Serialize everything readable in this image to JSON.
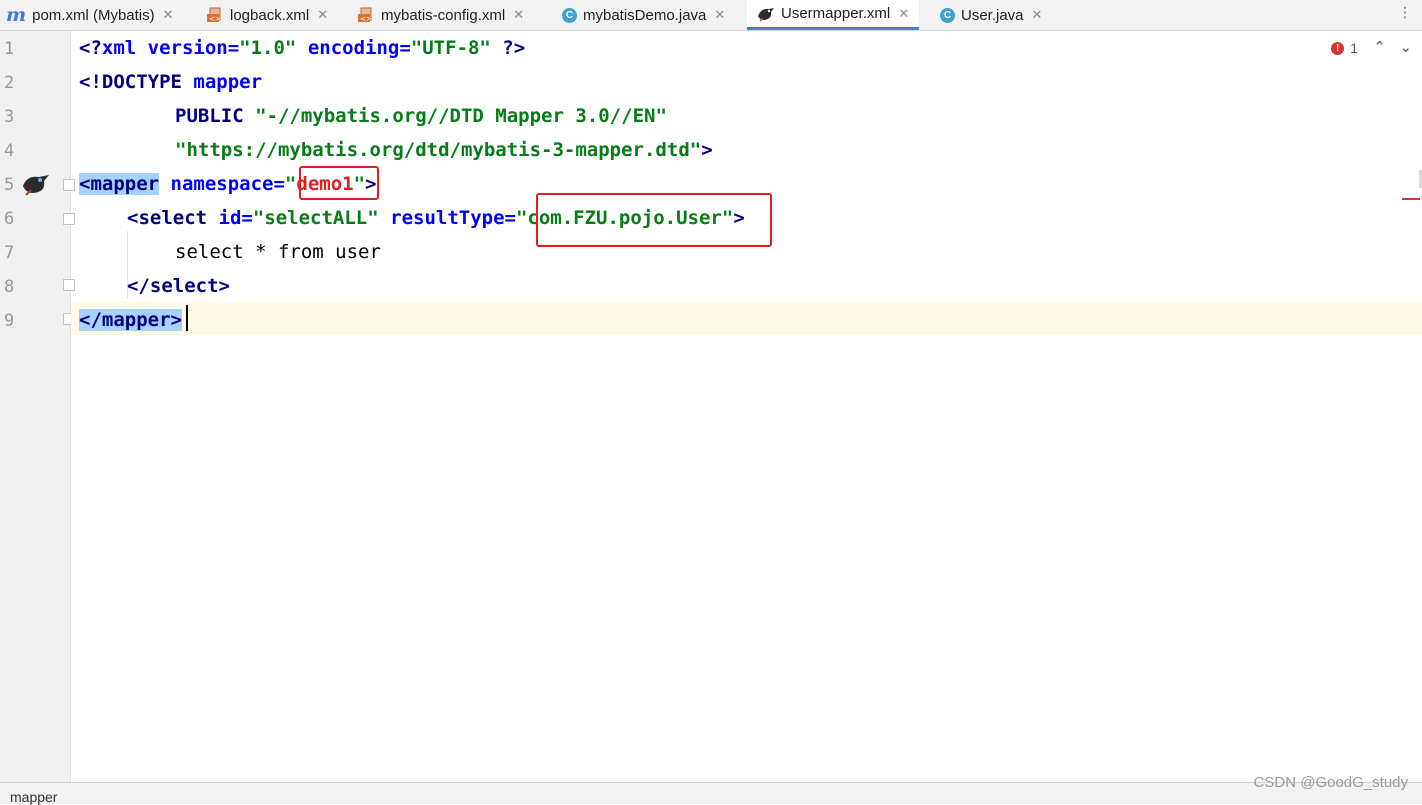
{
  "tabs": [
    {
      "label": "pom.xml (Mybatis)",
      "icon": "maven-icon",
      "close": "✕",
      "active": false
    },
    {
      "label": "logback.xml",
      "icon": "xml-file-icon",
      "close": "✕",
      "active": false
    },
    {
      "label": "mybatis-config.xml",
      "icon": "xml-file-icon",
      "close": "✕",
      "active": false
    },
    {
      "label": "mybatisDemo.java",
      "icon": "java-class-icon",
      "close": "✕",
      "active": false
    },
    {
      "label": "Usermapper.xml",
      "icon": "mybatis-bird-icon",
      "close": "✕",
      "active": true
    },
    {
      "label": "User.java",
      "icon": "java-class-icon",
      "close": "✕",
      "active": false
    }
  ],
  "gutter": {
    "line_numbers": [
      "1",
      "2",
      "3",
      "4",
      "5",
      "6",
      "7",
      "8",
      "9"
    ]
  },
  "code": {
    "l1": {
      "a": "<?",
      "b": "xml ",
      "c": "version=",
      "d": "\"1.0\"",
      "e": " encoding=",
      "f": "\"UTF-8\"",
      "g": " ?>"
    },
    "l2": {
      "a": "<!DOCTYPE ",
      "b": "mapper"
    },
    "l3": {
      "a": "PUBLIC ",
      "b": "\"-//mybatis.org//DTD Mapper 3.0//EN\""
    },
    "l4": {
      "a": "\"https://mybatis.org/dtd/mybatis-3-mapper.dtd\"",
      "b": ">"
    },
    "l5": {
      "a": "<mapper",
      "b": " namespace=",
      "c": "\"",
      "d": "demo1",
      "e": "\"",
      "f": ">"
    },
    "l6": {
      "a": "<select ",
      "b": "id=",
      "c": "\"selectALL\"",
      "d": " resultType=",
      "e": "\"com.FZU.pojo.User\"",
      "f": ">"
    },
    "l7": {
      "a": "select * from user"
    },
    "l8": {
      "a": "</select>"
    },
    "l9": {
      "a": "</mapper>"
    }
  },
  "inspections": {
    "error_count": "1",
    "error_icon": "!",
    "up": "⌃",
    "down": "⌄"
  },
  "breadcrumb": "mapper",
  "watermark": "CSDN @GoodG_study",
  "overflow": "⋮",
  "colors": {
    "tag": "#000080",
    "attr": "#0000ff",
    "string": "#067d17",
    "annotation_box": "#e02020",
    "active_tab_underline": "#4083c9"
  }
}
